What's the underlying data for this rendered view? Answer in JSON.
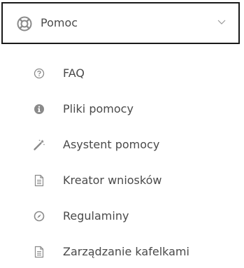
{
  "menu": {
    "header_label": "Pomoc",
    "header_icon": "lifebuoy-icon",
    "expanded": true,
    "items": [
      {
        "label": "FAQ",
        "icon": "question-circle-icon"
      },
      {
        "label": "Pliki pomocy",
        "icon": "info-circle-icon"
      },
      {
        "label": "Asystent pomocy",
        "icon": "magic-wand-icon"
      },
      {
        "label": "Kreator wniosków",
        "icon": "document-icon"
      },
      {
        "label": "Regulaminy",
        "icon": "compass-icon"
      },
      {
        "label": "Zarządzanie kafelkami",
        "icon": "document-icon"
      }
    ]
  },
  "colors": {
    "text": "#4a4a4a",
    "icon": "#8a8a8a",
    "border": "#1a1a1a"
  }
}
